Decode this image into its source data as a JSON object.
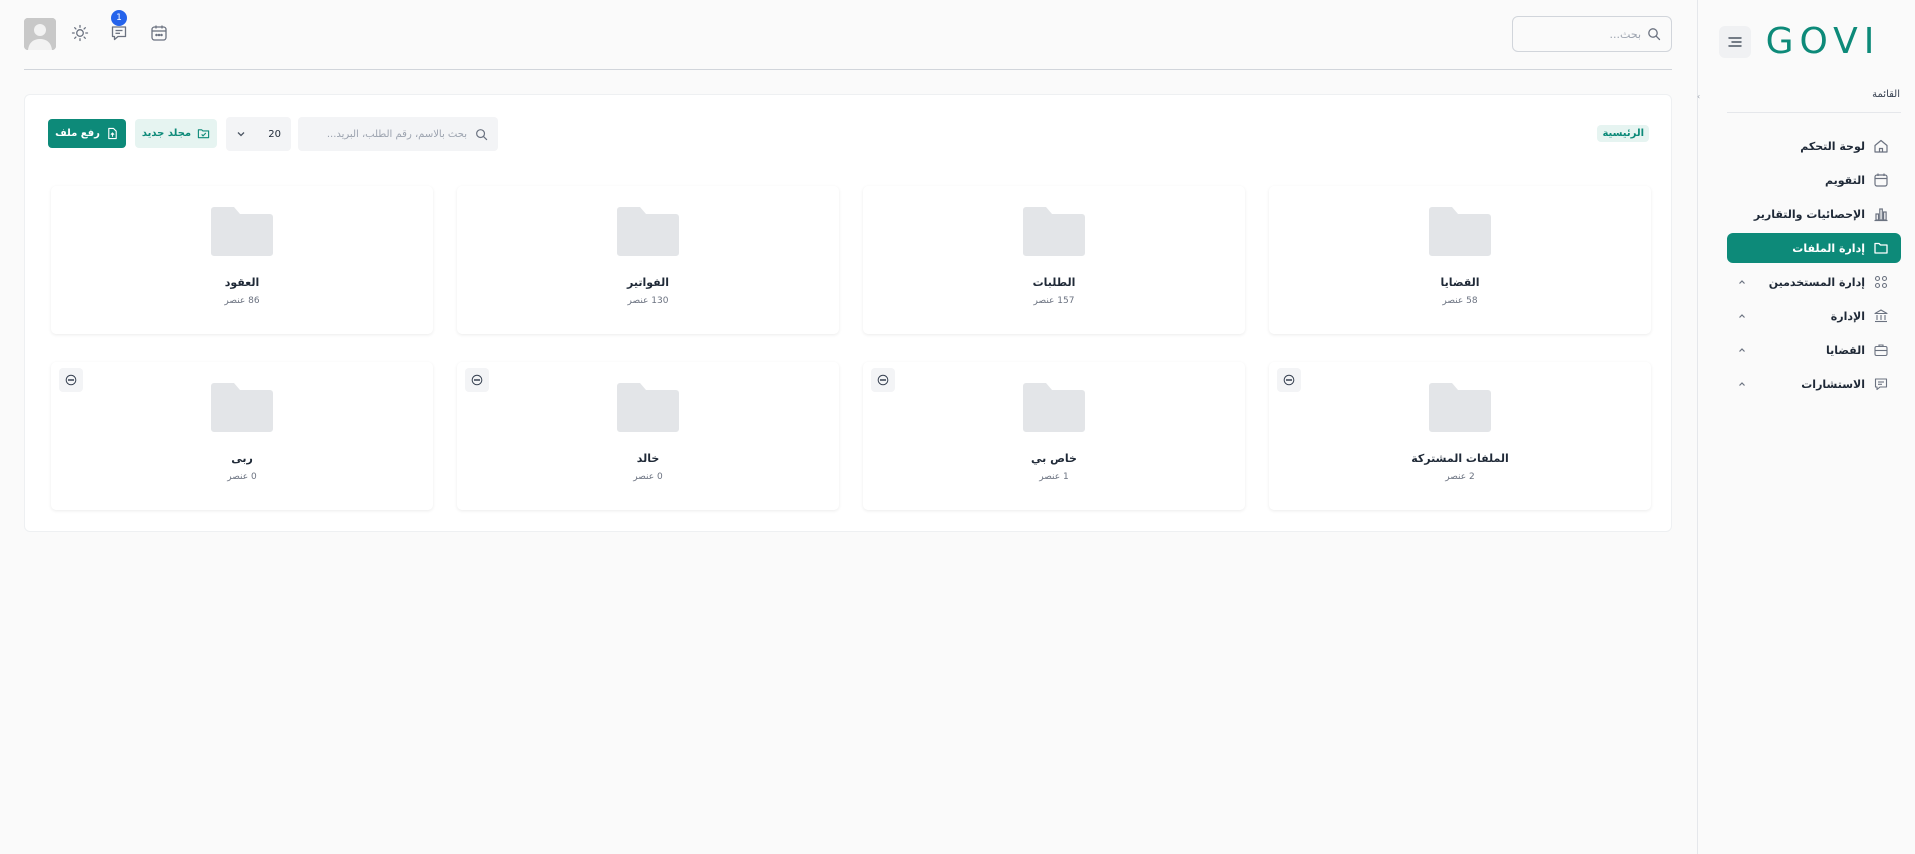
{
  "brand": {
    "logo_text": "GOVI",
    "color": "#0d8a79"
  },
  "sidebar": {
    "heading": "القائمة",
    "items": [
      {
        "label": "لوحة التحكم",
        "icon": "home-icon",
        "active": false,
        "expandable": false
      },
      {
        "label": "التقويم",
        "icon": "calendar-icon",
        "active": false,
        "expandable": false
      },
      {
        "label": "الإحصائيات والتقارير",
        "icon": "bar-chart-icon",
        "active": false,
        "expandable": false
      },
      {
        "label": "إدارة الملفات",
        "icon": "folder-icon",
        "active": true,
        "expandable": false
      },
      {
        "label": "إدارة المستخدمين",
        "icon": "users-icon",
        "active": false,
        "expandable": true
      },
      {
        "label": "الإدارة",
        "icon": "bank-icon",
        "active": false,
        "expandable": true
      },
      {
        "label": "القضايا",
        "icon": "briefcase-icon",
        "active": false,
        "expandable": true
      },
      {
        "label": "الاستشارات",
        "icon": "message-icon",
        "active": false,
        "expandable": true
      }
    ]
  },
  "topbar": {
    "search_placeholder": "بحث...",
    "notification_count": "1"
  },
  "file_manager": {
    "breadcrumb": "الرئيسية",
    "search_placeholder": "بحث بالاسم، رقم الطلب، البريد...",
    "page_size": "20",
    "new_folder_label": "مجلد جديد",
    "upload_label": "رفع ملف",
    "folders": [
      {
        "name": "القضايا",
        "count": "58 عنصر",
        "has_menu": false
      },
      {
        "name": "الطلبات",
        "count": "157 عنصر",
        "has_menu": false
      },
      {
        "name": "الفواتير",
        "count": "130 عنصر",
        "has_menu": false
      },
      {
        "name": "العقود",
        "count": "86 عنصر",
        "has_menu": false
      },
      {
        "name": "الملفات المشتركة",
        "count": "2 عنصر",
        "has_menu": true
      },
      {
        "name": "خاص بي",
        "count": "1 عنصر",
        "has_menu": true
      },
      {
        "name": "خالد",
        "count": "0 عنصر",
        "has_menu": true
      },
      {
        "name": "ربى",
        "count": "0 عنصر",
        "has_menu": true
      }
    ]
  }
}
